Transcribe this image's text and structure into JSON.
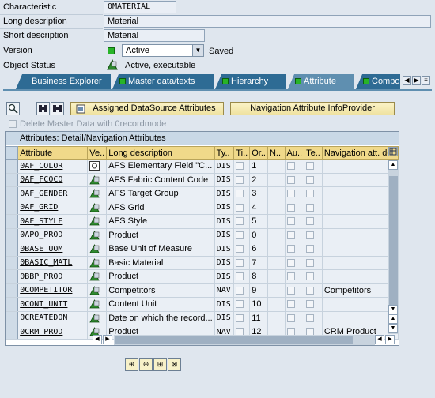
{
  "header": {
    "characteristic_label": "Characteristic",
    "characteristic_value": "0MATERIAL",
    "long_desc_label": "Long description",
    "long_desc_value": "Material",
    "short_desc_label": "Short description",
    "short_desc_value": "Material",
    "version_label": "Version",
    "version_value": "Active",
    "version_saved": "Saved",
    "object_status_label": "Object Status",
    "object_status_value": "Active, executable"
  },
  "tabs": [
    {
      "label": "Business Explorer"
    },
    {
      "label": "Master data/texts"
    },
    {
      "label": "Hierarchy"
    },
    {
      "label": "Attribute"
    },
    {
      "label": "Compo"
    }
  ],
  "toolbar": {
    "assigned_ds_label": "Assigned DataSource Attributes",
    "nav_attr_label": "Navigation Attribute InfoProvider",
    "delete_master_label": "Delete Master Data with 0recordmode"
  },
  "table": {
    "title": "Attributes: Detail/Navigation Attributes",
    "columns": [
      "Attribute",
      "Ve..",
      "Long description",
      "Ty..",
      "Ti..",
      "Or..",
      "N..",
      "Au..",
      "Te..",
      "Navigation att. des"
    ],
    "rows": [
      {
        "attr": "0AF_COLOR",
        "desc": "AFS Elementary Field \"C...",
        "type": "DIS",
        "order": "1",
        "nav": ""
      },
      {
        "attr": "0AF_FCOCO",
        "desc": "AFS Fabric Content Code",
        "type": "DIS",
        "order": "2",
        "nav": ""
      },
      {
        "attr": "0AF_GENDER",
        "desc": "AFS Target Group",
        "type": "DIS",
        "order": "3",
        "nav": ""
      },
      {
        "attr": "0AF_GRID",
        "desc": "AFS Grid",
        "type": "DIS",
        "order": "4",
        "nav": ""
      },
      {
        "attr": "0AF_STYLE",
        "desc": "AFS Style",
        "type": "DIS",
        "order": "5",
        "nav": ""
      },
      {
        "attr": "0APO_PROD",
        "desc": "Product",
        "type": "DIS",
        "order": "0",
        "nav": ""
      },
      {
        "attr": "0BASE_UOM",
        "desc": "Base Unit of Measure",
        "type": "DIS",
        "order": "6",
        "nav": ""
      },
      {
        "attr": "0BASIC_MATL",
        "desc": "Basic Material",
        "type": "DIS",
        "order": "7",
        "nav": ""
      },
      {
        "attr": "0BBP_PROD",
        "desc": "Product",
        "type": "DIS",
        "order": "8",
        "nav": ""
      },
      {
        "attr": "0COMPETITOR",
        "desc": "Competitors",
        "type": "NAV",
        "order": "9",
        "nav": "Competitors"
      },
      {
        "attr": "0CONT_UNIT",
        "desc": "Content Unit",
        "type": "DIS",
        "order": "10",
        "nav": ""
      },
      {
        "attr": "0CREATEDON",
        "desc": "Date on which the record...",
        "type": "DIS",
        "order": "11",
        "nav": ""
      },
      {
        "attr": "0CRM_PROD",
        "desc": "Product",
        "type": "NAV",
        "order": "12",
        "nav": "CRM Product"
      }
    ]
  },
  "colors": {
    "tab_active": "#5f8fb0",
    "tab": "#2e6b94",
    "header_row": "#f0d98a",
    "status_green": "#28b428"
  }
}
